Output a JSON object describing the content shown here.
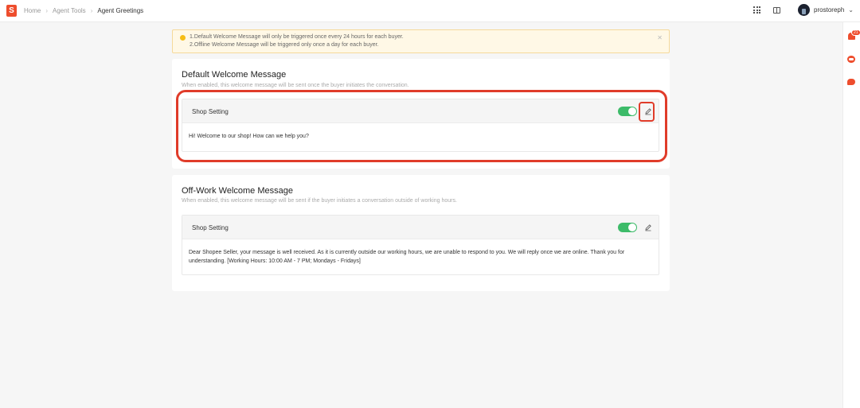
{
  "header": {
    "logo_text": "S",
    "breadcrumb": [
      "Home",
      "Agent Tools",
      "Agent Greetings"
    ],
    "username": "prostoreph"
  },
  "rail": {
    "notification_count": "21"
  },
  "notice": {
    "line1": "1.Default Welcome Message will only be triggered once every 24 hours for each buyer.",
    "line2": "2.Offline Welcome Message will be triggered only once a day for each buyer."
  },
  "sections": [
    {
      "title": "Default Welcome Message",
      "description": "When enabled, this welcome message will be sent once the buyer initiates the conversation.",
      "setting_label": "Shop Setting",
      "enabled": true,
      "message": "Hi! Welcome to our shop! How can we help you?"
    },
    {
      "title": "Off-Work Welcome Message",
      "description": "When enabled, this welcome message will be sent if the buyer initiates a conversation outside of working hours.",
      "setting_label": "Shop Setting",
      "enabled": true,
      "message": "Dear Shopee Seller, your message is well received. As it is currently outside our working hours, we are unable to respond to you. We will reply once we are online. Thank you for understanding. [Working Hours: 10:00 AM - 7 PM; Mondays - Fridays]"
    }
  ],
  "colors": {
    "brand": "#ee4d2d",
    "toggle_on": "#3dbb69",
    "highlight": "#e03c2a"
  }
}
